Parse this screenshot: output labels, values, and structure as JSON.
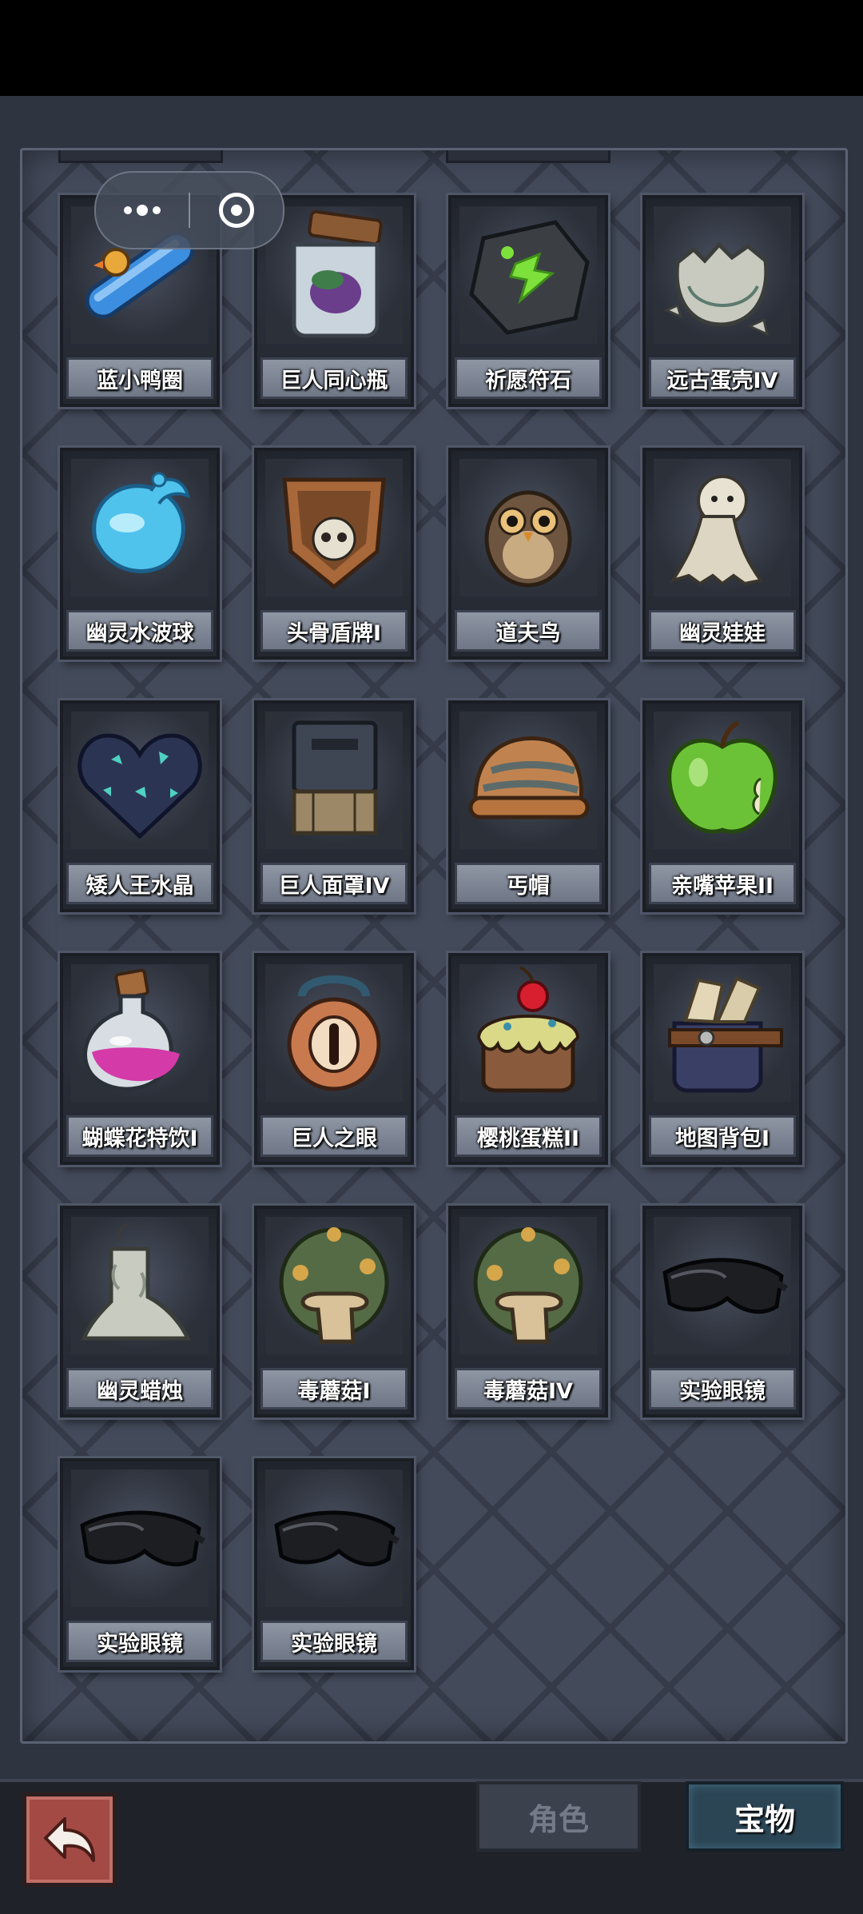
{
  "mini_program": {
    "more_icon": "more-dots-icon",
    "close_icon": "target-close-icon"
  },
  "items": [
    {
      "label": "蓝小鸭圈",
      "icon": "duck-swim-ring-icon"
    },
    {
      "label": "巨人同心瓶",
      "icon": "jar-icon"
    },
    {
      "label": "祈愿符石",
      "icon": "rune-stone-icon"
    },
    {
      "label": "远古蛋壳IV",
      "icon": "eggshell-icon"
    },
    {
      "label": "幽灵水波球",
      "icon": "water-orb-icon"
    },
    {
      "label": "头骨盾牌I",
      "icon": "skull-shield-icon"
    },
    {
      "label": "道夫鸟",
      "icon": "owl-icon"
    },
    {
      "label": "幽灵娃娃",
      "icon": "ghost-doll-icon"
    },
    {
      "label": "矮人王水晶",
      "icon": "crystal-heart-icon"
    },
    {
      "label": "巨人面罩IV",
      "icon": "mask-icon"
    },
    {
      "label": "丐帽",
      "icon": "beanie-hat-icon"
    },
    {
      "label": "亲嘴苹果II",
      "icon": "apple-icon"
    },
    {
      "label": "蝴蝶花特饮I",
      "icon": "potion-icon"
    },
    {
      "label": "巨人之眼",
      "icon": "eye-amulet-icon"
    },
    {
      "label": "樱桃蛋糕II",
      "icon": "cherry-cake-icon"
    },
    {
      "label": "地图背包I",
      "icon": "map-bag-icon"
    },
    {
      "label": "幽灵蜡烛",
      "icon": "ghost-candle-icon"
    },
    {
      "label": "毒蘑菇I",
      "icon": "poison-mushroom-icon"
    },
    {
      "label": "毒蘑菇IV",
      "icon": "poison-mushroom-icon"
    },
    {
      "label": "实验眼镜",
      "icon": "goggles-icon"
    },
    {
      "label": "实验眼镜",
      "icon": "goggles-icon"
    },
    {
      "label": "实验眼镜",
      "icon": "goggles-icon"
    }
  ],
  "bottom": {
    "back_icon": "back-arrow-icon",
    "tabs": [
      {
        "label": "角色",
        "active": false
      },
      {
        "label": "宝物",
        "active": true
      }
    ]
  }
}
